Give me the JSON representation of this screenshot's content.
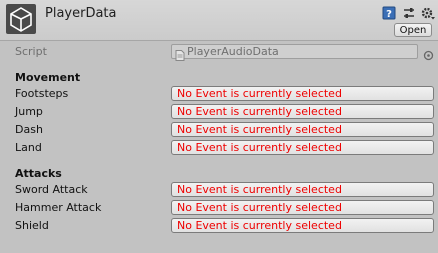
{
  "header": {
    "title": "PlayerData",
    "open_label": "Open"
  },
  "script_row": {
    "label": "Script",
    "value": "PlayerAudioData"
  },
  "sections": [
    {
      "title": "Movement",
      "props": [
        {
          "label": "Footsteps",
          "value": "No Event is currently selected"
        },
        {
          "label": "Jump",
          "value": "No Event is currently selected"
        },
        {
          "label": "Dash",
          "value": "No Event is currently selected"
        },
        {
          "label": "Land",
          "value": "No Event is currently selected"
        }
      ]
    },
    {
      "title": "Attacks",
      "props": [
        {
          "label": "Sword Attack",
          "value": "No Event is currently selected"
        },
        {
          "label": "Hammer Attack",
          "value": "No Event is currently selected"
        },
        {
          "label": "Shield",
          "value": "No Event is currently selected"
        }
      ]
    }
  ],
  "colors": {
    "background": "#c2c2c2",
    "error_text": "#ee0000"
  },
  "icons": [
    "unity-logo-icon",
    "help-icon",
    "settings-icon",
    "gear-icon",
    "script-file-icon",
    "object-picker-icon"
  ]
}
